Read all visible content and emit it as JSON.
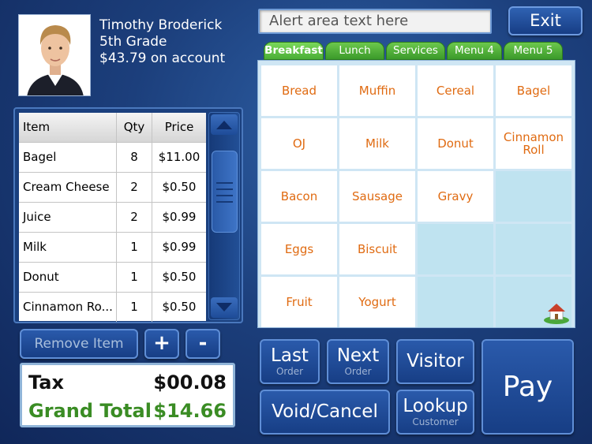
{
  "customer": {
    "name": "Timothy Broderick",
    "grade": "5th Grade",
    "balance": "$43.79 on account"
  },
  "alert": {
    "text": "Alert area text here"
  },
  "exit_label": "Exit",
  "tabs": [
    {
      "label": "Breakfast",
      "active": true
    },
    {
      "label": "Lunch"
    },
    {
      "label": "Services"
    },
    {
      "label": "Menu 4"
    },
    {
      "label": "Menu 5"
    }
  ],
  "menu": {
    "items": [
      "Bread",
      "Muffin",
      "Cereal",
      "Bagel",
      "OJ",
      "Milk",
      "Donut",
      "Cinnamon Roll",
      "Bacon",
      "Sausage",
      "Gravy",
      "",
      "Eggs",
      "Biscuit",
      "",
      "",
      "Fruit",
      "Yogurt",
      "",
      ""
    ]
  },
  "order": {
    "headers": [
      "Item",
      "Qty",
      "Price"
    ],
    "rows": [
      [
        "Bagel",
        "8",
        "$11.00"
      ],
      [
        "Cream Cheese",
        "2",
        "$0.50"
      ],
      [
        "Juice",
        "2",
        "$0.99"
      ],
      [
        "Milk",
        "1",
        "$0.99"
      ],
      [
        "Donut",
        "1",
        "$0.50"
      ],
      [
        "Cinnamon Ro...",
        "1",
        "$0.50"
      ]
    ]
  },
  "controls": {
    "remove": "Remove Item",
    "plus": "+",
    "minus": "-"
  },
  "totals": {
    "tax_label": "Tax",
    "tax_value": "$00.08",
    "grand_label": "Grand Total",
    "grand_value": "$14.66"
  },
  "actions": {
    "last": {
      "big": "Last",
      "small": "Order"
    },
    "next": {
      "big": "Next",
      "small": "Order"
    },
    "visitor": "Visitor",
    "void_cancel": "Void/Cancel",
    "lookup": {
      "big": "Lookup",
      "small": "Customer"
    },
    "pay": "Pay"
  },
  "colors": {
    "menu_text": "#e06b12",
    "tab_green": "#4aae36",
    "grand_total": "#3a8c24"
  }
}
